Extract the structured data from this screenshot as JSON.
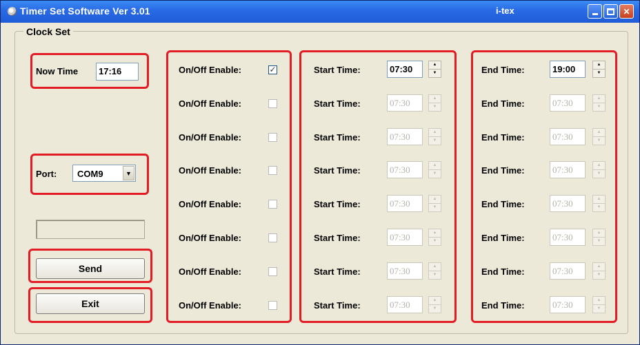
{
  "window": {
    "title": "Timer Set Software Ver 3.01",
    "subtitle": "i-tex",
    "colors": {
      "titlebar": "#2a6ce6",
      "highlight_box": "#e21b24",
      "background": "#ece9d8"
    }
  },
  "clock_set": {
    "group_label": "Clock Set",
    "now_time_label": "Now Time",
    "now_time_value": "17:16",
    "port_label": "Port:",
    "port_value": "COM9",
    "send_label": "Send",
    "exit_label": "Exit"
  },
  "timers": [
    {
      "enable_label": "On/Off Enable:",
      "enabled": true,
      "start_label": "Start Time:",
      "start_value": "07:30",
      "end_label": "End Time:",
      "end_value": "19:00"
    },
    {
      "enable_label": "On/Off Enable:",
      "enabled": false,
      "start_label": "Start Time:",
      "start_value": "07:30",
      "end_label": "End Time:",
      "end_value": "07:30"
    },
    {
      "enable_label": "On/Off Enable:",
      "enabled": false,
      "start_label": "Start Time:",
      "start_value": "07:30",
      "end_label": "End Time:",
      "end_value": "07:30"
    },
    {
      "enable_label": "On/Off Enable:",
      "enabled": false,
      "start_label": "Start Time:",
      "start_value": "07:30",
      "end_label": "End Time:",
      "end_value": "07:30"
    },
    {
      "enable_label": "On/Off Enable:",
      "enabled": false,
      "start_label": "Start Time:",
      "start_value": "07:30",
      "end_label": "End Time:",
      "end_value": "07:30"
    },
    {
      "enable_label": "On/Off Enable:",
      "enabled": false,
      "start_label": "Start Time:",
      "start_value": "07:30",
      "end_label": "End Time:",
      "end_value": "07:30"
    },
    {
      "enable_label": "On/Off Enable:",
      "enabled": false,
      "start_label": "Start Time:",
      "start_value": "07:30",
      "end_label": "End Time:",
      "end_value": "07:30"
    },
    {
      "enable_label": "On/Off Enable:",
      "enabled": false,
      "start_label": "Start Time:",
      "start_value": "07:30",
      "end_label": "End Time:",
      "end_value": "07:30"
    }
  ]
}
